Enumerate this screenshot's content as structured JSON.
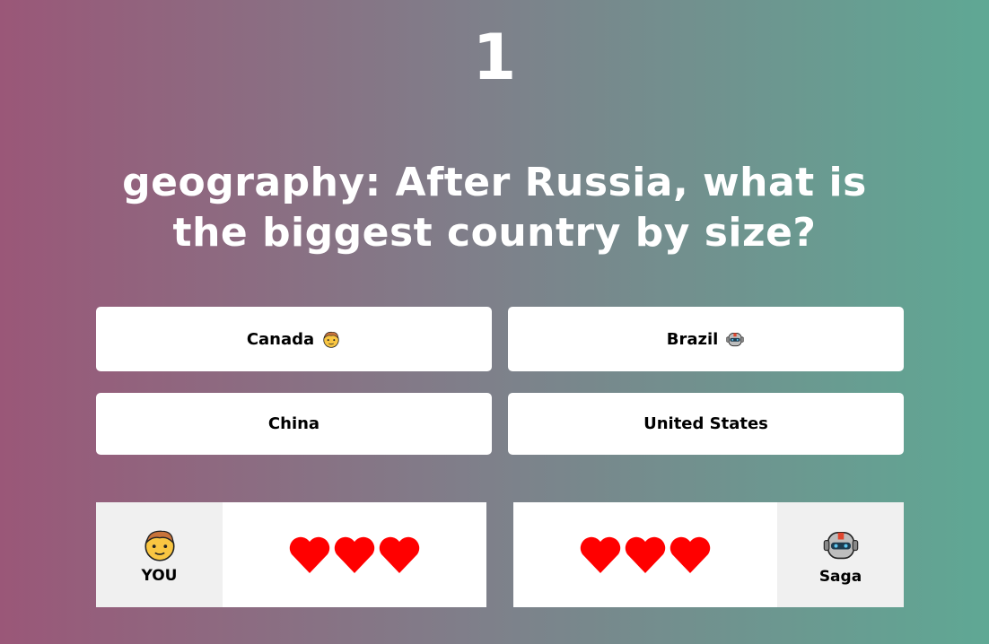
{
  "round": "1",
  "question": "geography: After Russia, what is the biggest country by size?",
  "answers": [
    {
      "label": "Canada",
      "picked_by": "player"
    },
    {
      "label": "Brazil",
      "picked_by": "opponent"
    },
    {
      "label": "China"
    },
    {
      "label": "United States"
    }
  ],
  "player": {
    "name": "YOU",
    "lives": 3,
    "avatar_icon": "boy-face-icon"
  },
  "opponent": {
    "name": "Saga",
    "lives": 3,
    "avatar_icon": "robot-icon"
  },
  "colors": {
    "heart": "#ff0000",
    "panel": "#ffffff",
    "avatar_bg": "#f0f0f0"
  }
}
